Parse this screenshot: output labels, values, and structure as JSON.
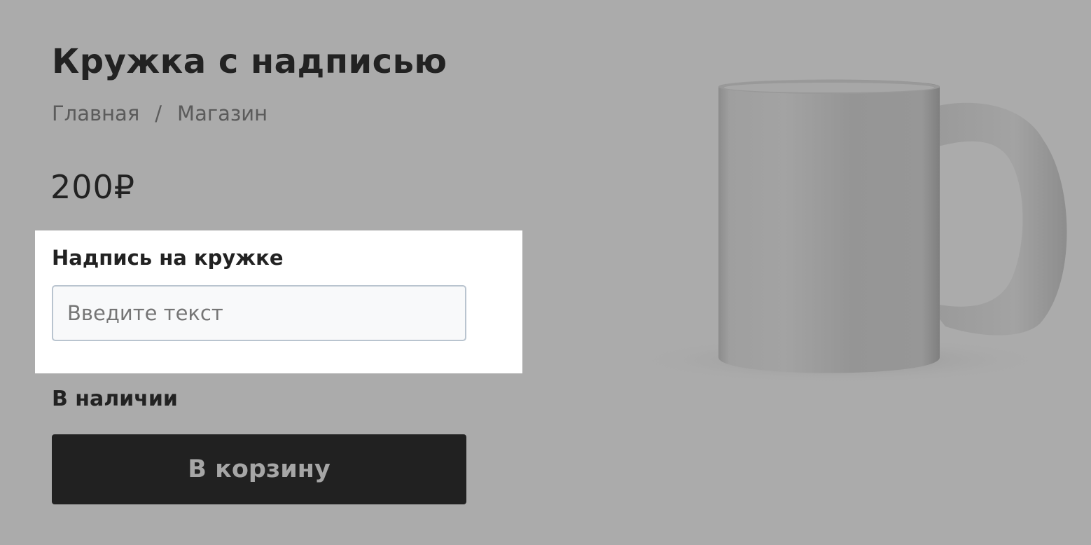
{
  "product": {
    "title": "Кружка с надписью",
    "price": "200₽",
    "stock_status": "В наличии",
    "image_alt": "mug-image"
  },
  "breadcrumb": {
    "items": [
      "Главная",
      "Магазин"
    ],
    "separator": "/"
  },
  "option": {
    "label": "Надпись на кружке",
    "value": "",
    "placeholder": "Введите текст"
  },
  "cart": {
    "button_label": "В корзину"
  },
  "colors": {
    "overlay_background": "#ababab",
    "highlight_panel": "#ffffff",
    "button_background": "#212121",
    "button_text": "#a6a6a6"
  }
}
